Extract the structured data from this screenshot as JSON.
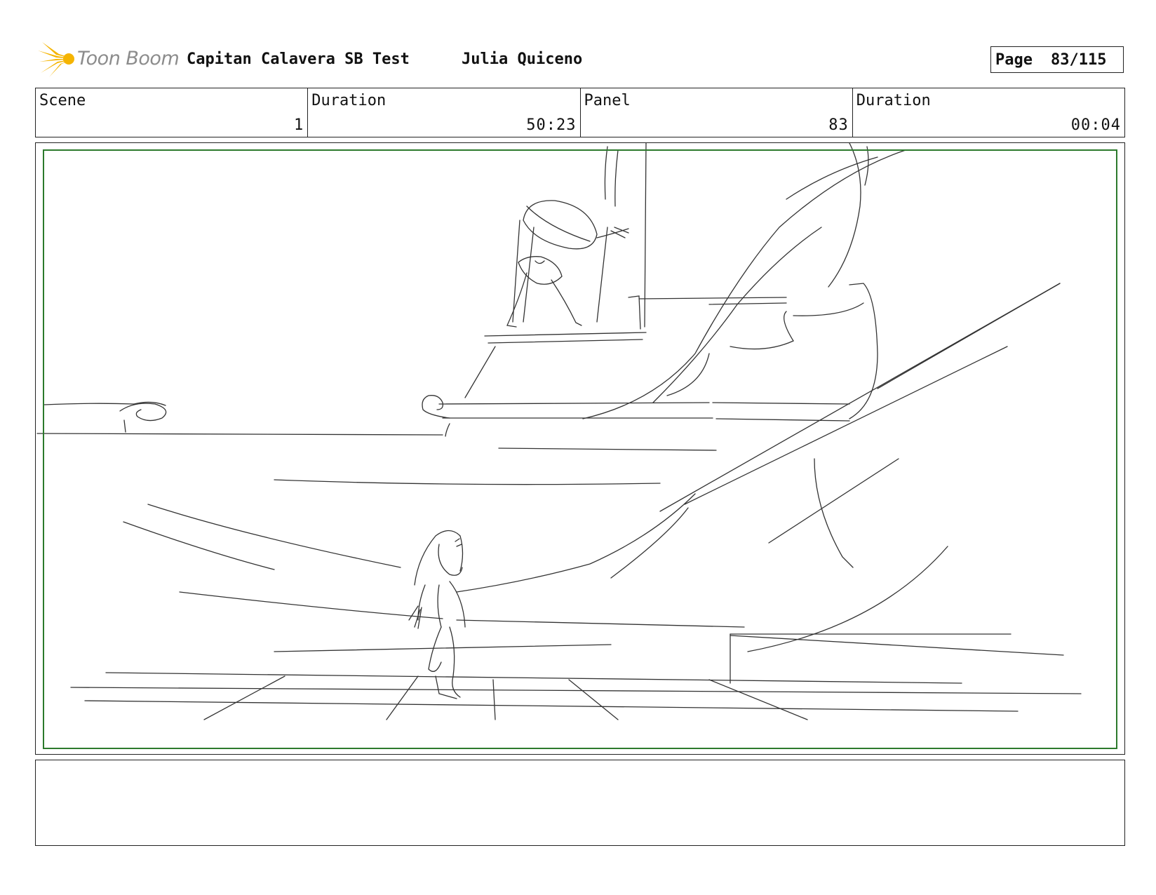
{
  "header": {
    "logo_text": "Toon Boom",
    "project_title": "Capitan Calavera SB Test",
    "author": "Julia Quiceno",
    "page_label": "Page",
    "page_value": "83/115"
  },
  "info": {
    "scene_label": "Scene",
    "scene_value": "1",
    "duration_label": "Duration",
    "duration_value": "50:23",
    "panel_label": "Panel",
    "panel_value": "83",
    "panel_duration_label": "Duration",
    "panel_duration_value": "00:04"
  },
  "colors": {
    "safe_frame": "#2c7a2c",
    "logo_yellow": "#f5b400",
    "logo_text": "#8c8c8c"
  },
  "icons": {
    "logo": "toon-boom-burst-icon"
  },
  "caption": {
    "text": ""
  }
}
